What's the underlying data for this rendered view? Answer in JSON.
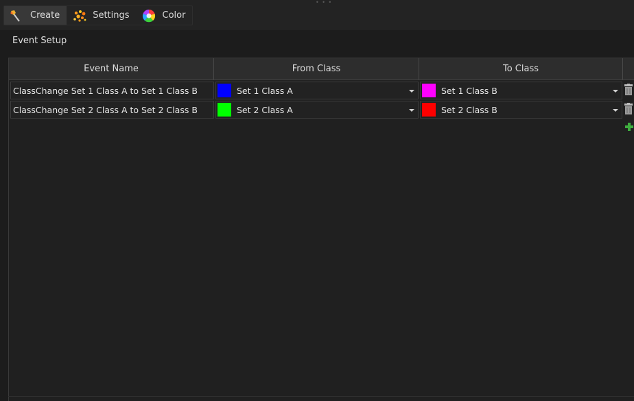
{
  "tabs": [
    {
      "label": "Create",
      "icon": "wand-icon",
      "active": true
    },
    {
      "label": "Settings",
      "icon": "particles-icon",
      "active": false
    },
    {
      "label": "Color",
      "icon": "color-wheel-icon",
      "active": false
    }
  ],
  "section": {
    "title": "Event Setup"
  },
  "table": {
    "columns": [
      "Event Name",
      "From Class",
      "To Class"
    ],
    "rows": [
      {
        "name": "ClassChange Set 1 Class A to Set 1 Class B",
        "from": {
          "label": "Set 1 Class A",
          "color": "#0000ff"
        },
        "to": {
          "label": "Set 1 Class B",
          "color": "#ff00ff"
        }
      },
      {
        "name": "ClassChange Set 2 Class A to Set 2 Class B",
        "from": {
          "label": "Set 2 Class A",
          "color": "#00ff00"
        },
        "to": {
          "label": "Set 2 Class B",
          "color": "#ff0000"
        }
      }
    ]
  },
  "icons": {
    "delete": "trash-icon",
    "add": "plus-icon"
  },
  "colors": {
    "background": "#1c1c1c",
    "header": "#2d2d2d",
    "add_green": "#3fae3f"
  }
}
